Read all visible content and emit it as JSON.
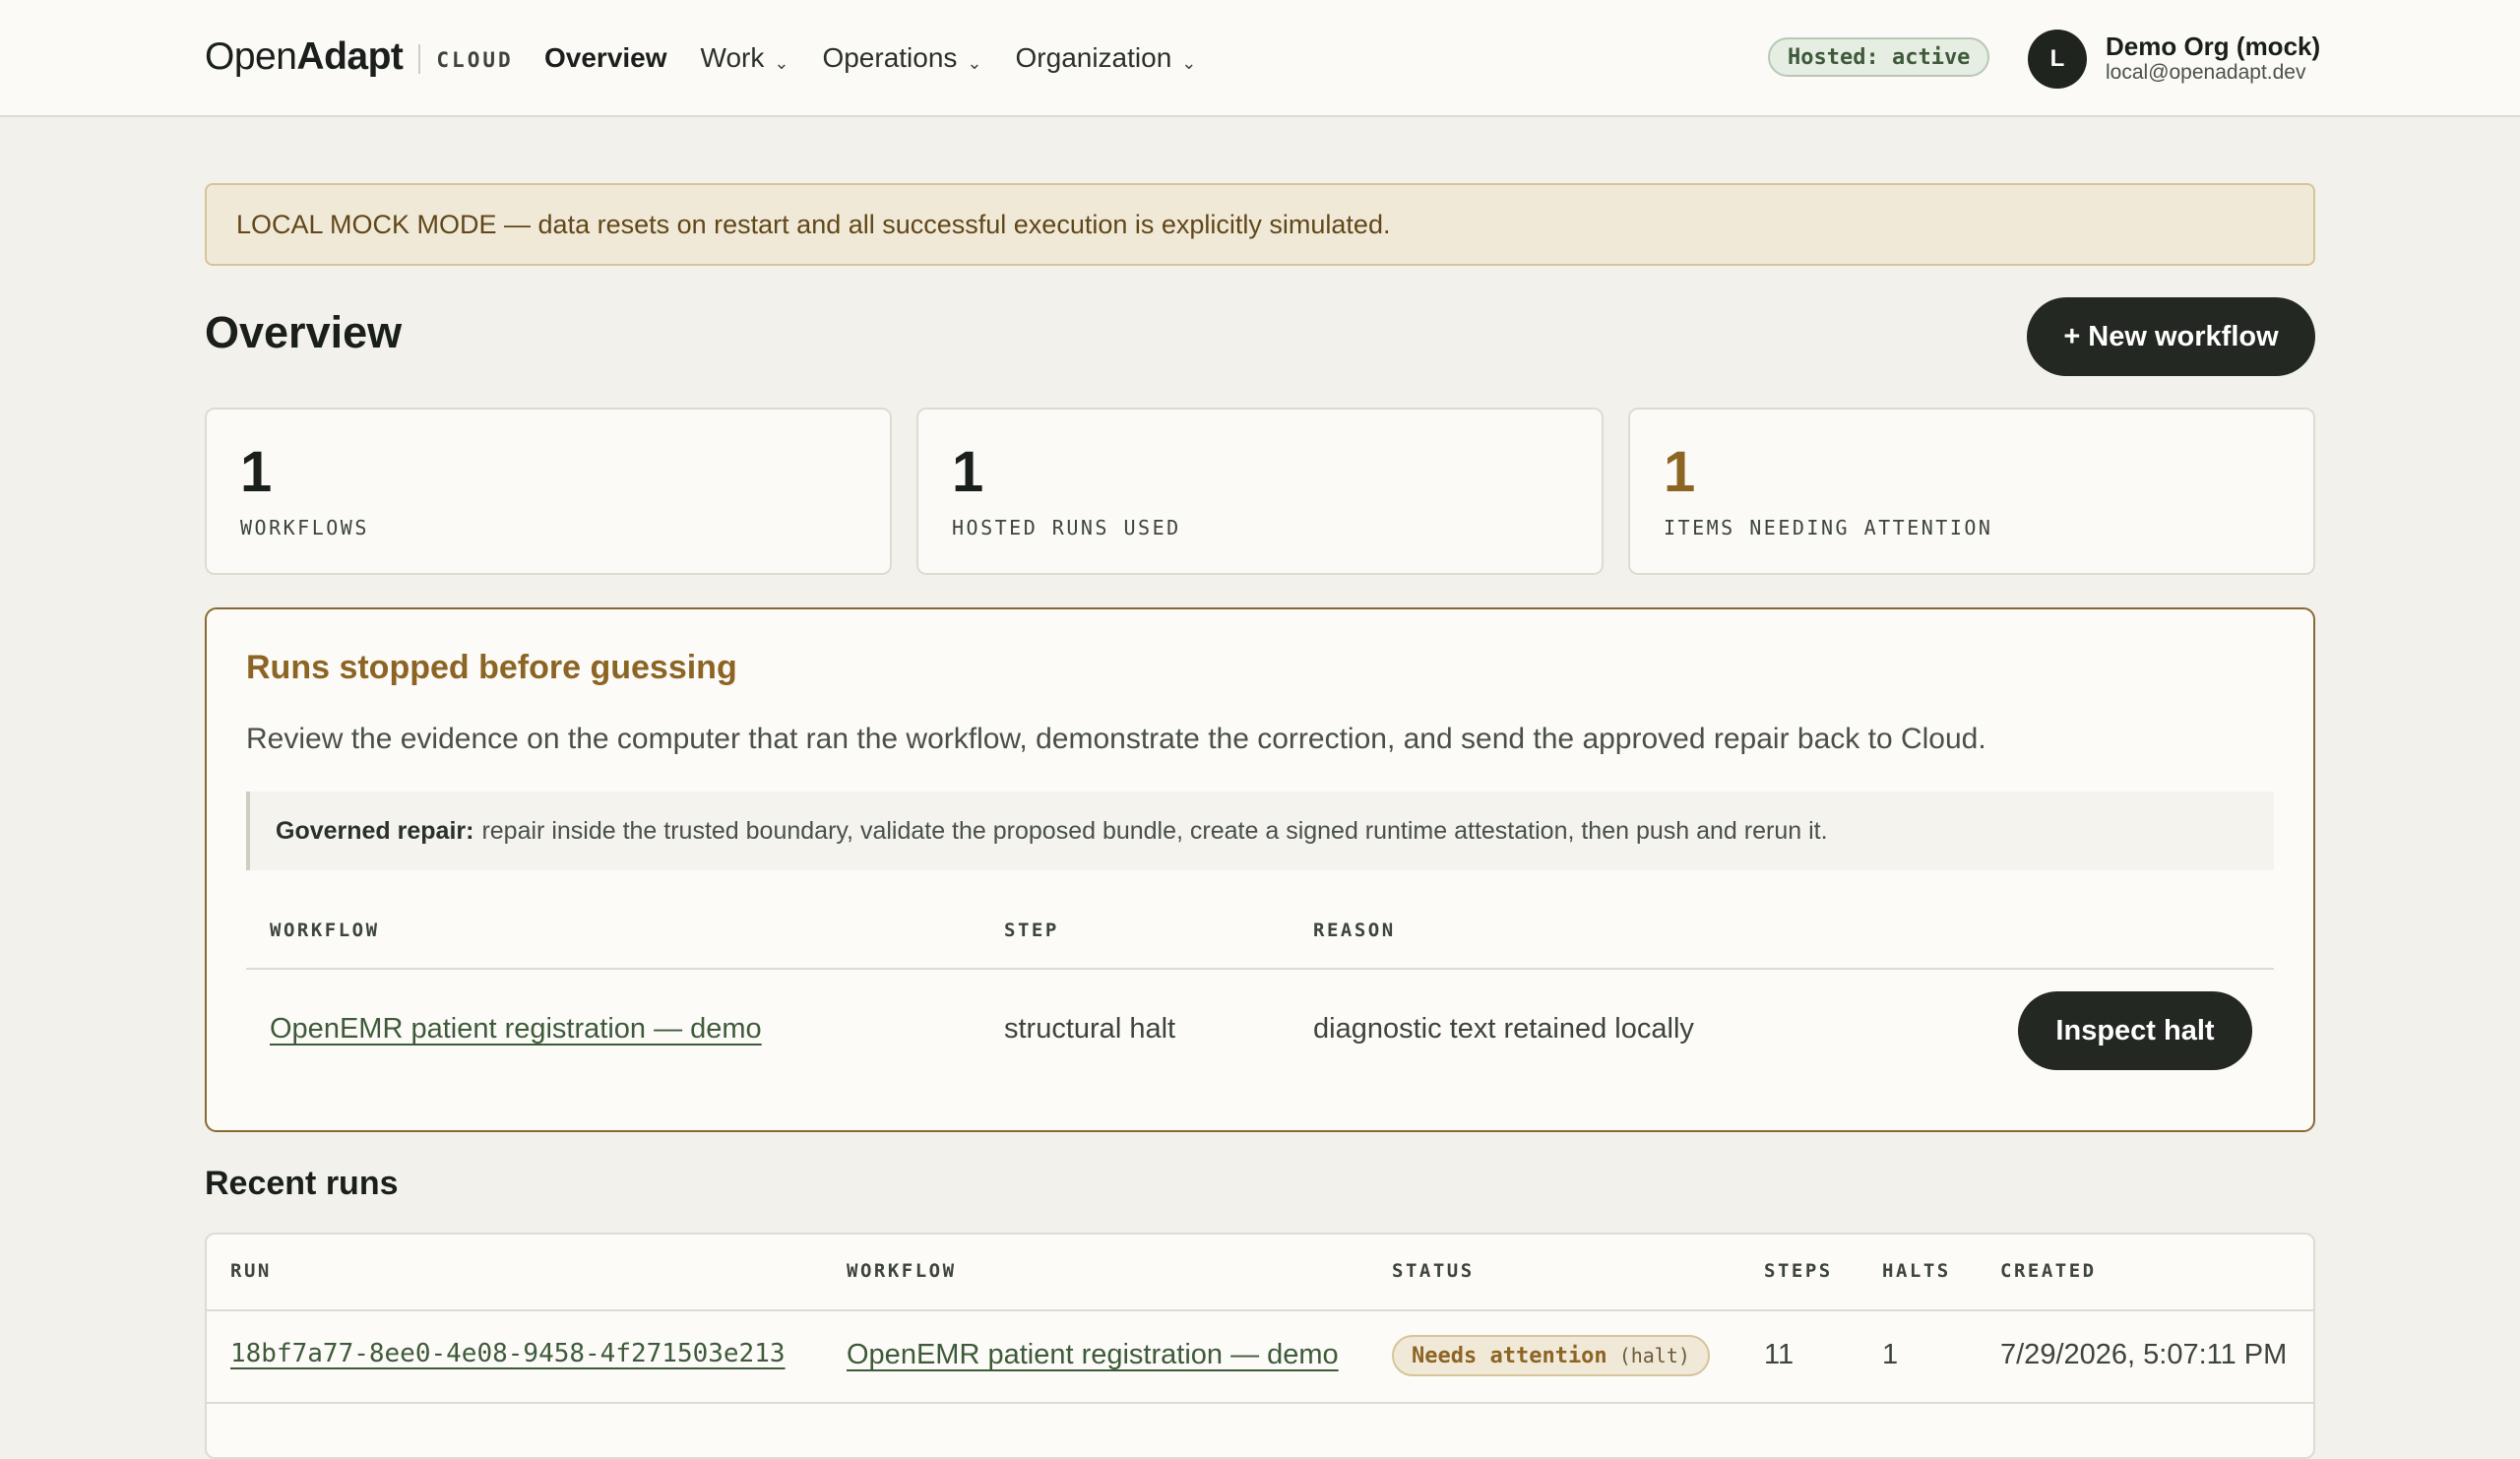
{
  "header": {
    "logo_open": "Open",
    "logo_adapt": "Adapt",
    "brand_sub": "CLOUD",
    "nav": [
      {
        "label": "Overview"
      },
      {
        "label": "Work"
      },
      {
        "label": "Operations"
      },
      {
        "label": "Organization"
      }
    ],
    "hosted_status": "Hosted: active",
    "avatar_initial": "L",
    "user_name": "Demo Org (mock)",
    "user_email": "local@openadapt.dev"
  },
  "banner": "LOCAL MOCK MODE — data resets on restart and all successful execution is explicitly simulated.",
  "overview": {
    "title": "Overview",
    "new_workflow_label": "+ New workflow",
    "stats": [
      {
        "value": "1",
        "label": "WORKFLOWS"
      },
      {
        "value": "1",
        "label": "HOSTED RUNS USED"
      },
      {
        "value": "1",
        "label": "ITEMS NEEDING ATTENTION"
      }
    ]
  },
  "halts": {
    "title": "Runs stopped before guessing",
    "description": "Review the evidence on the computer that ran the workflow, demonstrate the correction, and send the approved repair back to Cloud.",
    "callout_bold": "Governed repair:",
    "callout_text": "repair inside the trusted boundary, validate the proposed bundle, create a signed runtime attestation, then push and rerun it.",
    "columns": [
      "WORKFLOW",
      "STEP",
      "REASON"
    ],
    "rows": [
      {
        "workflow": "OpenEMR patient registration — demo",
        "step": "structural halt",
        "reason": "diagnostic text retained locally",
        "action": "Inspect halt"
      }
    ]
  },
  "recent_runs": {
    "title": "Recent runs",
    "columns": [
      "RUN",
      "WORKFLOW",
      "STATUS",
      "STEPS",
      "HALTS",
      "CREATED"
    ],
    "rows": [
      {
        "run": "18bf7a77-8ee0-4e08-9458-4f271503e213",
        "workflow": "OpenEMR patient registration — demo",
        "status": "Needs attention",
        "status_detail": "(halt)",
        "steps": "11",
        "halts": "1",
        "created": "7/29/2026, 5:07:11 PM"
      }
    ]
  },
  "colors": {
    "background": "#f2f1ec",
    "accent_gold": "#8c6423",
    "link_green": "#3e5a3a",
    "button_dark": "#232822"
  }
}
